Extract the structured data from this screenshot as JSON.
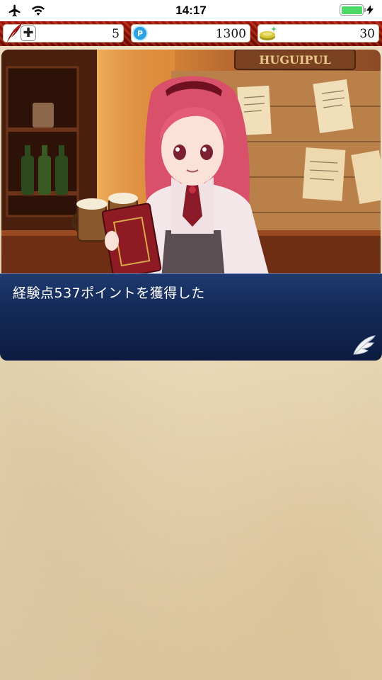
{
  "status_bar": {
    "time": "14:17"
  },
  "resources": {
    "stamina": "5",
    "points": "1300",
    "coins": "30"
  },
  "dialog": {
    "message": "経験点537ポイントを獲得した"
  },
  "scene": {
    "sign_text": "HUGUIPUL"
  }
}
